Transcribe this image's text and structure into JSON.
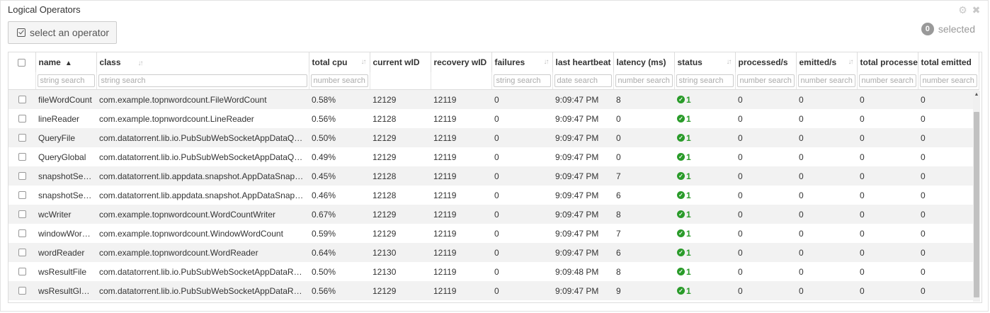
{
  "panel": {
    "title": "Logical Operators"
  },
  "toolbar": {
    "select_label": "select an operator",
    "selected_count": "0",
    "selected_label": "selected"
  },
  "columns": [
    {
      "label": "name"
    },
    {
      "label": "class"
    },
    {
      "label": "total cpu"
    },
    {
      "label": "current wID"
    },
    {
      "label": "recovery wID"
    },
    {
      "label": "failures"
    },
    {
      "label": "last heartbeat"
    },
    {
      "label": "latency (ms)"
    },
    {
      "label": "status"
    },
    {
      "label": "processed/s"
    },
    {
      "label": "emitted/s"
    },
    {
      "label": "total processed"
    },
    {
      "label": "total emitted"
    }
  ],
  "filters": {
    "name": "string search",
    "class": "string search",
    "cpu": "number search",
    "failures": "string search",
    "heartbeat": "date search",
    "latency": "number search",
    "status": "string search",
    "processed": "number search",
    "emitted": "number search",
    "total_processed": "number search",
    "total_emitted": "number search"
  },
  "rows": [
    {
      "name": "fileWordCount",
      "class": "com.example.topnwordcount.FileWordCount",
      "cpu": "0.58%",
      "cur": "12129",
      "rec": "12119",
      "fail": "0",
      "hb": "9:09:47 PM",
      "lat": "8",
      "status": "1",
      "proc": "0",
      "emit": "0",
      "tproc": "0",
      "temit": "0"
    },
    {
      "name": "lineReader",
      "class": "com.example.topnwordcount.LineReader",
      "cpu": "0.56%",
      "cur": "12128",
      "rec": "12119",
      "fail": "0",
      "hb": "9:09:47 PM",
      "lat": "0",
      "status": "1",
      "proc": "0",
      "emit": "0",
      "tproc": "0",
      "temit": "0"
    },
    {
      "name": "QueryFile",
      "class": "com.datatorrent.lib.io.PubSubWebSocketAppDataQ…",
      "cpu": "0.50%",
      "cur": "12129",
      "rec": "12119",
      "fail": "0",
      "hb": "9:09:47 PM",
      "lat": "0",
      "status": "1",
      "proc": "0",
      "emit": "0",
      "tproc": "0",
      "temit": "0"
    },
    {
      "name": "QueryGlobal",
      "class": "com.datatorrent.lib.io.PubSubWebSocketAppDataQ…",
      "cpu": "0.49%",
      "cur": "12129",
      "rec": "12119",
      "fail": "0",
      "hb": "9:09:47 PM",
      "lat": "0",
      "status": "1",
      "proc": "0",
      "emit": "0",
      "tproc": "0",
      "temit": "0"
    },
    {
      "name": "snapshotSe…",
      "class": "com.datatorrent.lib.appdata.snapshot.AppDataSnap…",
      "cpu": "0.45%",
      "cur": "12128",
      "rec": "12119",
      "fail": "0",
      "hb": "9:09:47 PM",
      "lat": "7",
      "status": "1",
      "proc": "0",
      "emit": "0",
      "tproc": "0",
      "temit": "0"
    },
    {
      "name": "snapshotSe…",
      "class": "com.datatorrent.lib.appdata.snapshot.AppDataSnap…",
      "cpu": "0.46%",
      "cur": "12128",
      "rec": "12119",
      "fail": "0",
      "hb": "9:09:47 PM",
      "lat": "6",
      "status": "1",
      "proc": "0",
      "emit": "0",
      "tproc": "0",
      "temit": "0"
    },
    {
      "name": "wcWriter",
      "class": "com.example.topnwordcount.WordCountWriter",
      "cpu": "0.67%",
      "cur": "12129",
      "rec": "12119",
      "fail": "0",
      "hb": "9:09:47 PM",
      "lat": "8",
      "status": "1",
      "proc": "0",
      "emit": "0",
      "tproc": "0",
      "temit": "0"
    },
    {
      "name": "windowWor…",
      "class": "com.example.topnwordcount.WindowWordCount",
      "cpu": "0.59%",
      "cur": "12129",
      "rec": "12119",
      "fail": "0",
      "hb": "9:09:47 PM",
      "lat": "7",
      "status": "1",
      "proc": "0",
      "emit": "0",
      "tproc": "0",
      "temit": "0"
    },
    {
      "name": "wordReader",
      "class": "com.example.topnwordcount.WordReader",
      "cpu": "0.64%",
      "cur": "12130",
      "rec": "12119",
      "fail": "0",
      "hb": "9:09:47 PM",
      "lat": "6",
      "status": "1",
      "proc": "0",
      "emit": "0",
      "tproc": "0",
      "temit": "0"
    },
    {
      "name": "wsResultFile",
      "class": "com.datatorrent.lib.io.PubSubWebSocketAppDataRe…",
      "cpu": "0.50%",
      "cur": "12130",
      "rec": "12119",
      "fail": "0",
      "hb": "9:09:48 PM",
      "lat": "8",
      "status": "1",
      "proc": "0",
      "emit": "0",
      "tproc": "0",
      "temit": "0"
    },
    {
      "name": "wsResultGl…",
      "class": "com.datatorrent.lib.io.PubSubWebSocketAppDataRe…",
      "cpu": "0.56%",
      "cur": "12129",
      "rec": "12119",
      "fail": "0",
      "hb": "9:09:47 PM",
      "lat": "9",
      "status": "1",
      "proc": "0",
      "emit": "0",
      "tproc": "0",
      "temit": "0"
    }
  ]
}
